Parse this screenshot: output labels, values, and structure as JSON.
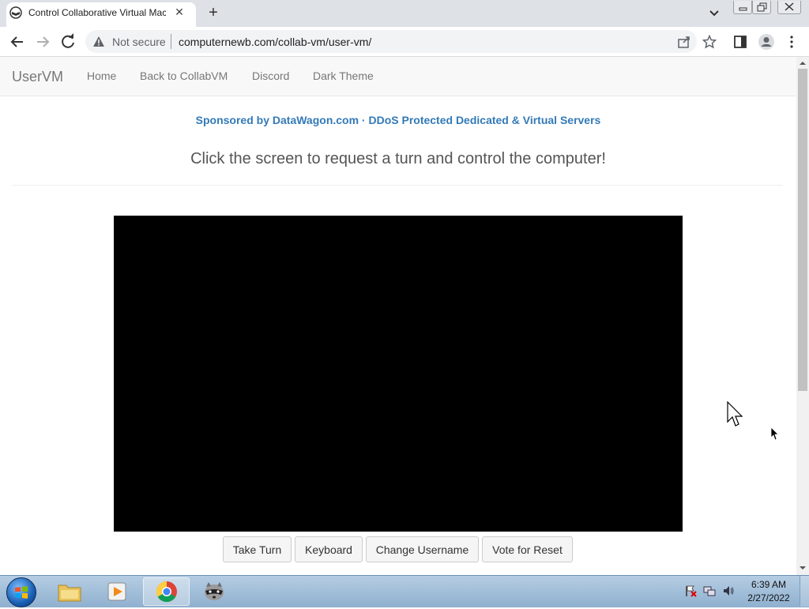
{
  "browser": {
    "tab_title": "Control Collaborative Virtual Machine",
    "tab_close": "✕",
    "new_tab": "+",
    "not_secure": "Not secure",
    "url": "computernewb.com/collab-vm/user-vm/"
  },
  "navbar": {
    "brand": "UserVM",
    "links": [
      "Home",
      "Back to CollabVM",
      "Discord",
      "Dark Theme"
    ]
  },
  "main": {
    "sponsor": "Sponsored by DataWagon.com · DDoS Protected Dedicated & Virtual Servers",
    "lead": "Click the screen to request a turn and control the computer!",
    "buttons": [
      "Take Turn",
      "Keyboard",
      "Change Username",
      "Vote for Reset"
    ]
  },
  "taskbar": {
    "time": "6:39 AM",
    "date": "2/27/2022"
  },
  "colors": {
    "link": "#337ab7",
    "vm_screen": "#000000"
  }
}
